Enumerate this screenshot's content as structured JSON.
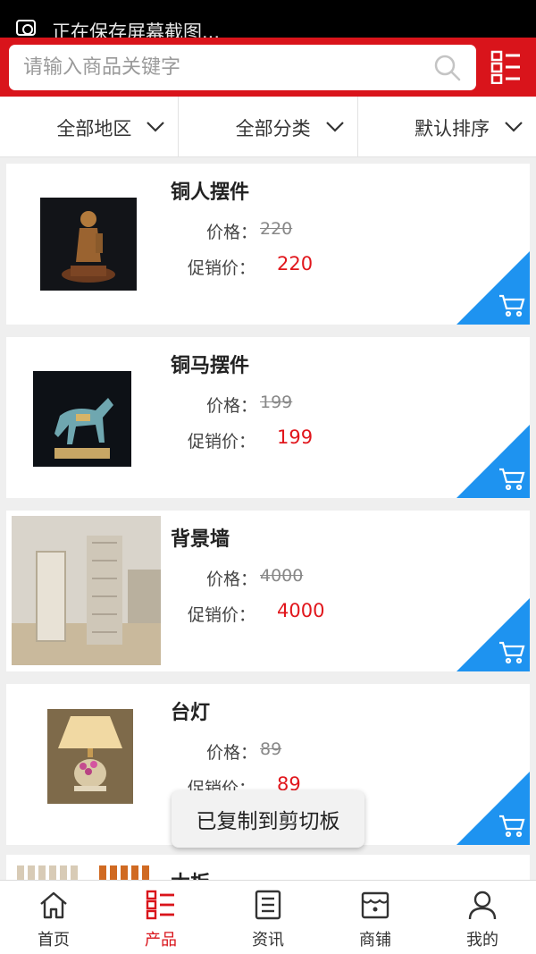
{
  "status": {
    "text": "正在保存屏幕截图..."
  },
  "search": {
    "placeholder": "请输入商品关键字"
  },
  "filters": [
    {
      "label": "全部地区"
    },
    {
      "label": "全部分类"
    },
    {
      "label": "默认排序"
    }
  ],
  "products": [
    {
      "name": "铜人摆件",
      "price_label": "价格：",
      "price": "220",
      "promo_label": "促销价：",
      "promo_price": "220"
    },
    {
      "name": "铜马摆件",
      "price_label": "价格：",
      "price": "199",
      "promo_label": "促销价：",
      "promo_price": "199"
    },
    {
      "name": "背景墙",
      "price_label": "价格：",
      "price": "4000",
      "promo_label": "促销价：",
      "promo_price": "4000"
    },
    {
      "name": "台灯",
      "price_label": "价格：",
      "price": "89",
      "promo_label": "促销价：",
      "promo_price": "89"
    },
    {
      "name": "木板"
    }
  ],
  "toast": {
    "text": "已复制到剪切板"
  },
  "tabs": [
    {
      "label": "首页",
      "icon": "home-icon"
    },
    {
      "label": "产品",
      "icon": "product-list-icon",
      "active": true
    },
    {
      "label": "资讯",
      "icon": "news-icon"
    },
    {
      "label": "商铺",
      "icon": "shop-icon"
    },
    {
      "label": "我的",
      "icon": "user-icon"
    }
  ],
  "colors": {
    "brand": "#d9141b",
    "promo": "#e1161c",
    "cart": "#1e93f0"
  }
}
